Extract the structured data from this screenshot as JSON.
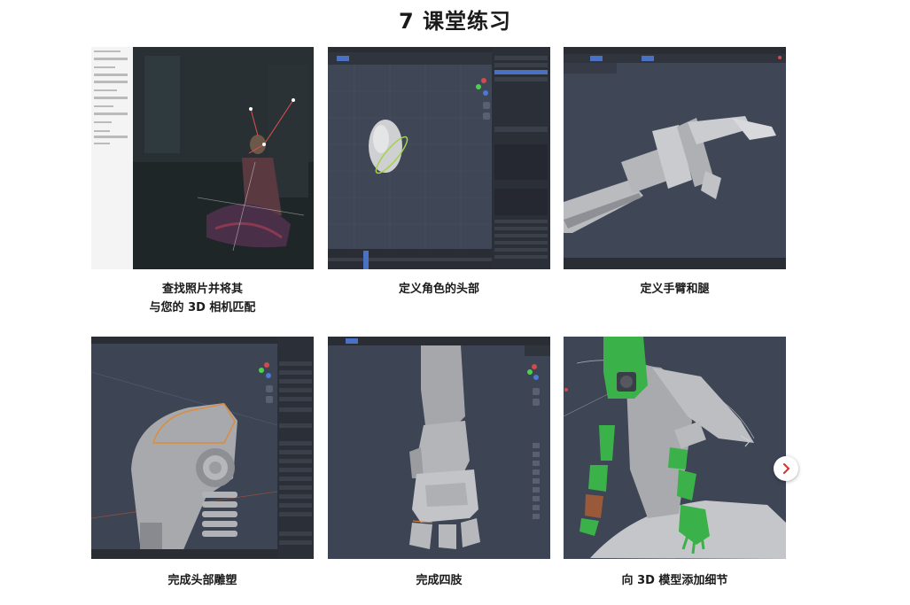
{
  "page": {
    "title": "7 课堂练习"
  },
  "lessons": [
    {
      "caption_line1": "查找照片并将其",
      "caption_line2": "与您的 3D 相机匹配"
    },
    {
      "caption_line1": "定义角色的头部",
      "caption_line2": ""
    },
    {
      "caption_line1": "定义手臂和腿",
      "caption_line2": ""
    },
    {
      "caption_line1": "完成头部雕塑",
      "caption_line2": ""
    },
    {
      "caption_line1": "完成四肢",
      "caption_line2": ""
    },
    {
      "caption_line1": "向 3D 模型添加细节",
      "caption_line2": ""
    }
  ],
  "carousel": {
    "next_icon": "chevron-right-icon"
  },
  "colors": {
    "viewport_bg": "#3d4454",
    "panel_bg": "#2b2f38",
    "model_gray": "#a9abaf",
    "highlight_green": "#3bb14a",
    "selection_orange": "#e08a3a",
    "chevron_red": "#d0312d"
  }
}
